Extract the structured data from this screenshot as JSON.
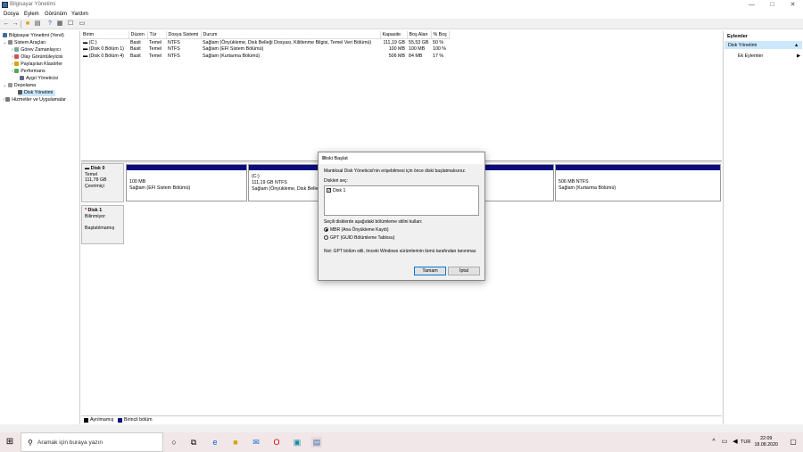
{
  "window": {
    "title": "Bilgisayar Yönetimi",
    "min": "—",
    "max": "□",
    "close": "✕"
  },
  "menu": [
    "Dosya",
    "Eylem",
    "Görünüm",
    "Yardım"
  ],
  "tree": {
    "root": "Bilgisayar Yönetimi (Yerel)",
    "system_tools": "Sistem Araçları",
    "task_scheduler": "Görev Zamanlayıcı",
    "event_viewer": "Olay Görüntüleyicisi",
    "shared_folders": "Paylaşılan Klasörler",
    "performance": "Performans",
    "device_manager": "Aygıt Yöneticisi",
    "storage": "Depolama",
    "disk_management": "Disk Yönetimi",
    "services": "Hizmetler ve Uygulamalar"
  },
  "volume_table": {
    "headers": [
      "Birim",
      "Düzen",
      "Tür",
      "Dosya Sistemi",
      "Durum",
      "Kapasite",
      "Boş Alan",
      "% Boş"
    ],
    "rows": [
      [
        "(C:)",
        "Basit",
        "Temel",
        "NTFS",
        "Sağlam (Önyükleme, Disk Belleği Dosyası, Kilitlenme Bilgisi, Temel Veri Bölümü)",
        "111,19 GB",
        "55,53 GB",
        "50 %"
      ],
      [
        "(Disk 0 Bölüm 1)",
        "Basit",
        "Temel",
        "NTFS",
        "Sağlam (EFI Sistem Bölümü)",
        "100 MB",
        "100 MB",
        "100 %"
      ],
      [
        "(Disk 0 Bölüm 4)",
        "Basit",
        "Temel",
        "NTFS",
        "Sağlam (Kurtarma Bölümü)",
        "506 MB",
        "84 MB",
        "17 %"
      ]
    ]
  },
  "disk0": {
    "name": "Disk 0",
    "type": "Temel",
    "size": "111,78 GB",
    "status": "Çevrimiçi",
    "p1_size": "100 MB",
    "p1_status": "Sağlam (EFI Sistem Bölümü)",
    "p2_name": "(C:)",
    "p2_size": "111,19 GB NTFS",
    "p2_status": "Sağlam (Önyükleme, Disk Belle",
    "p3_size": "506 MB NTFS",
    "p3_status": "Sağlam (Kurtarma Bölümü)"
  },
  "disk1": {
    "name": "Disk 1",
    "status1": "Bilinmiyor",
    "status2": "Başlatılmamış"
  },
  "legend": {
    "unallocated": "Ayrılmamış",
    "primary": "Birincil bölüm"
  },
  "actions": {
    "header": "Eylemler",
    "section": "Disk Yönetimi",
    "more": "Ek Eylemler"
  },
  "dialog": {
    "title": "Diski Başlat",
    "intro": "Mantıksal Disk Yöneticisi'nin erişebilmesi için önce diski başlatmalısınız.",
    "select_label": "Diskleri seç:",
    "disk_item": "Disk 1",
    "style_label": "Seçili disklerde aşağıdaki bölümleme stilini kullan:",
    "mbr": "MBR (Ana Önyükleme Kaydı)",
    "gpt": "GPT (GUID Bölümleme Tablosu)",
    "note": "Not: GPT bölüm stili, önceki Windows sürümlerinin tümü tarafından tanınmaz.",
    "ok": "Tamam",
    "cancel": "İptal"
  },
  "taskbar": {
    "search_placeholder": "Aramak için buraya yazın",
    "lang": "TUR",
    "time": "22:09",
    "date": "18.08.2020"
  }
}
